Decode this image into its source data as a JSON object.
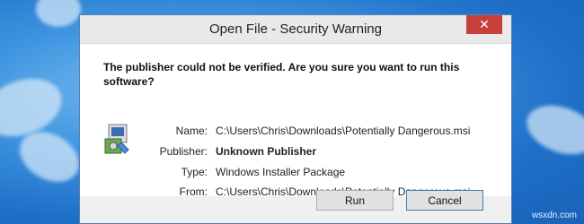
{
  "dialog": {
    "title": "Open File - Security Warning",
    "close_glyph": "✕",
    "question": "The publisher could not be verified.  Are you sure you want to run this software?",
    "icon": "installer-package-icon",
    "details": [
      {
        "label": "Name:",
        "value": "C:\\Users\\Chris\\Downloads\\Potentially Dangerous.msi",
        "bold": false
      },
      {
        "label": "Publisher:",
        "value": "Unknown Publisher",
        "bold": true
      },
      {
        "label": "Type:",
        "value": "Windows Installer Package",
        "bold": false
      },
      {
        "label": "From:",
        "value": "C:\\Users\\Chris\\Downloads\\Potentially Dangerous.msi",
        "bold": false
      }
    ],
    "buttons": {
      "run": "Run",
      "cancel": "Cancel"
    }
  },
  "watermark": "wsxdn.com"
}
